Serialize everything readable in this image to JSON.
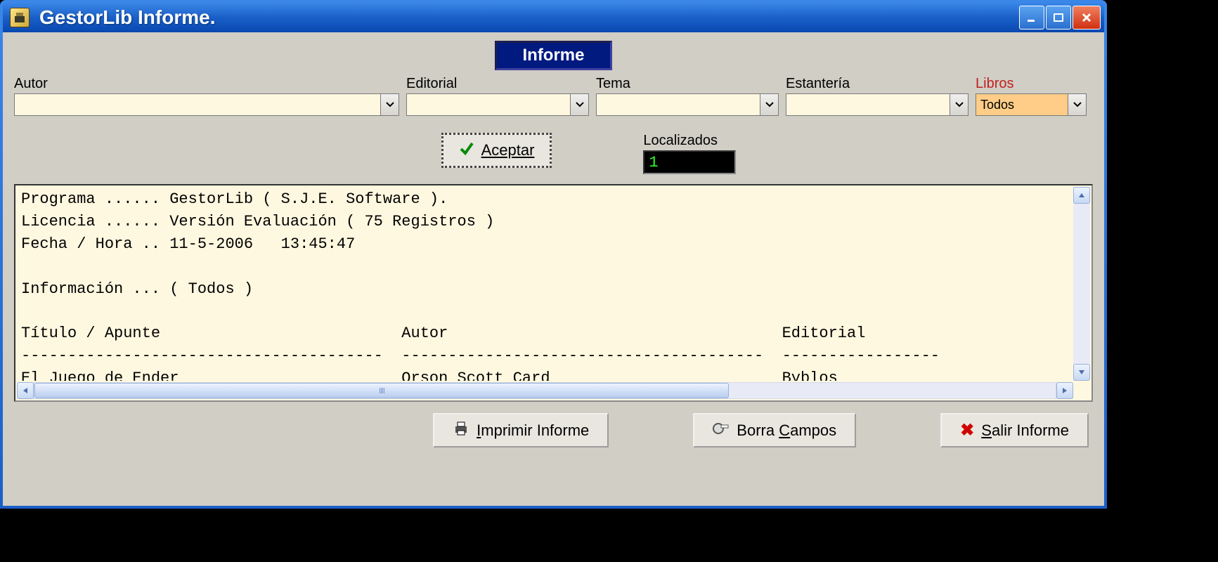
{
  "window": {
    "title": "GestorLib  Informe."
  },
  "header": {
    "badge": "Informe"
  },
  "filters": {
    "autor": {
      "label": "Autor",
      "value": ""
    },
    "editorial": {
      "label": "Editorial",
      "value": ""
    },
    "tema": {
      "label": "Tema",
      "value": ""
    },
    "estanteria": {
      "label": "Estantería",
      "value": ""
    },
    "libros": {
      "label": "Libros",
      "value": "Todos"
    }
  },
  "accept_label": "Aceptar",
  "localizados": {
    "label": "Localizados",
    "value": "1"
  },
  "report": {
    "line_programa": "Programa ...... GestorLib ( S.J.E. Software ).",
    "line_licencia": "Licencia ...... Versión Evaluación ( 75 Registros )",
    "line_fecha": "Fecha / Hora .. 11-5-2006   13:45:47",
    "line_info": "Información ... ( Todos )",
    "col_titulo": "Título / Apunte",
    "col_autor": "Autor",
    "col_editorial": "Editorial",
    "sep_titulo": "---------------------------------------",
    "sep_autor": "---------------------------------------",
    "sep_editorial": "-----------------",
    "row1_titulo": "El Juego de Ender",
    "row1_autor": "Orson Scott Card",
    "row1_editorial": "Byblos"
  },
  "footer": {
    "imprimir": "Imprimir Informe",
    "borra": "Borra Campos",
    "salir": "Salir Informe"
  }
}
